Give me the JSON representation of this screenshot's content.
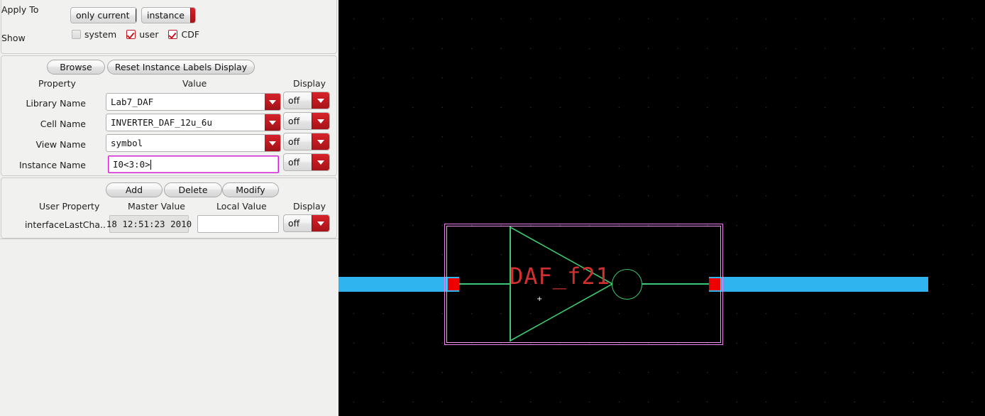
{
  "dialog": {
    "apply_to": {
      "label": "Apply To",
      "scope_value": "only current",
      "target_value": "instance"
    },
    "show": {
      "label": "Show",
      "options": [
        {
          "label": "system",
          "checked": false
        },
        {
          "label": "user",
          "checked": true
        },
        {
          "label": "CDF",
          "checked": true
        }
      ]
    },
    "actions": {
      "browse": "Browse",
      "reset_labels": "Reset Instance Labels Display"
    },
    "table_headers": {
      "property": "Property",
      "value": "Value",
      "display": "Display"
    },
    "rows": [
      {
        "label": "Library Name",
        "value": "Lab7_DAF",
        "display": "off"
      },
      {
        "label": "Cell Name",
        "value": "INVERTER_DAF_12u_6u",
        "display": "off"
      },
      {
        "label": "View Name",
        "value": "symbol",
        "display": "off"
      },
      {
        "label": "Instance Name",
        "value": "I0<3:0>",
        "display": "off"
      }
    ],
    "user_actions": {
      "add": "Add",
      "delete": "Delete",
      "modify": "Modify"
    },
    "user_headers": {
      "property": "User Property",
      "master_value": "Master Value",
      "local_value": "Local Value",
      "display": "Display"
    },
    "user_rows": [
      {
        "label": "interfaceLastCha..",
        "master_value": "18 12:51:23 2010",
        "local_value": "",
        "display": "off"
      }
    ]
  },
  "canvas": {
    "symbol_label": "DAF_f21",
    "cursor_marker": "+",
    "colors": {
      "background": "#000000",
      "grid_dot": "#4a4a4a",
      "wire": "#2fb4f0",
      "selection": "#ef7fef",
      "symbol": "#3bc86e",
      "pin": "#ee0000",
      "label": "#d03030"
    }
  }
}
